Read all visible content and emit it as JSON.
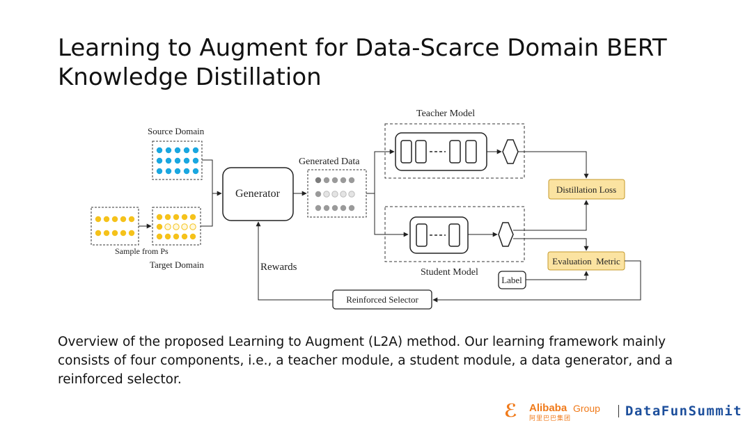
{
  "slide": {
    "title": "Learning to Augment for Data-Scarce Domain BERT Knowledge Distillation",
    "caption": "Overview of the proposed Learning to Augment (L2A) method. Our learning framework mainly consists of four components, i.e., a teacher module, a student module, a data generator, and a reinforced selector."
  },
  "diagram": {
    "source_domain": "Source Domain",
    "target_domain": "Target Domain",
    "sample_from": "Sample from Ps",
    "generator": "Generator",
    "generated_data": "Generated Data",
    "teacher_model": "Teacher Model",
    "student_model": "Student Model",
    "distillation_loss": "Distillation Loss",
    "evaluation_metric": "Evaluation  Metric",
    "label": "Label",
    "rewards": "Rewards",
    "reinforced_selector": "Reinforced Selector"
  },
  "colors": {
    "source_dots": "#1aa7e0",
    "target_dots": "#f5c21b",
    "generated_dots": "#9a9a9a",
    "loss_box_fill": "#fbe3a1",
    "loss_box_stroke": "#c49a2a"
  },
  "footer": {
    "logo_glyph": "ℰ",
    "alibaba": "Alibaba",
    "group": "Group",
    "alibaba_cn": "阿里巴巴集团",
    "brand": "DataFunSummit"
  }
}
